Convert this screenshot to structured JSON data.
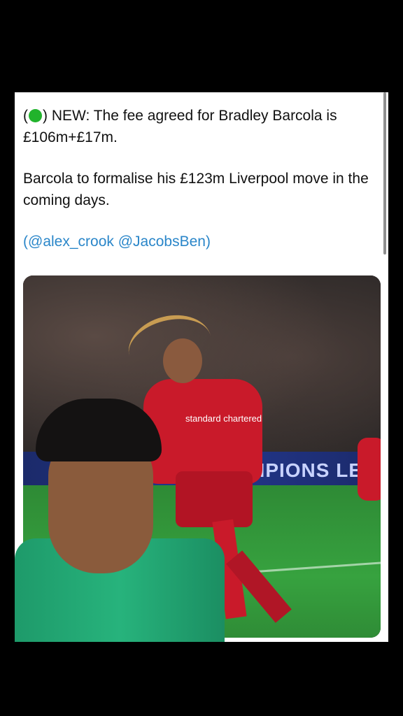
{
  "tweet": {
    "paragraphs": [
      {
        "open_paren": "(",
        "status_icon": "green-circle-icon",
        "text": ") NEW: The fee agreed for Bradley Barcola is £106m+£17m."
      },
      {
        "text": "Barcola to formalise his £123m Liverpool move in the coming days."
      },
      {
        "open_paren": "(",
        "mention1": "@alex_crook",
        "space": " ",
        "mention2": "@JacobsBen",
        "close_paren": ")"
      }
    ]
  },
  "photo": {
    "board_text": "MPIONS LE",
    "sponsor": "standard chartered"
  },
  "colors": {
    "mention": "#2a86c9",
    "status_dot": "#21b32c",
    "kit_red": "#c91a2a"
  }
}
